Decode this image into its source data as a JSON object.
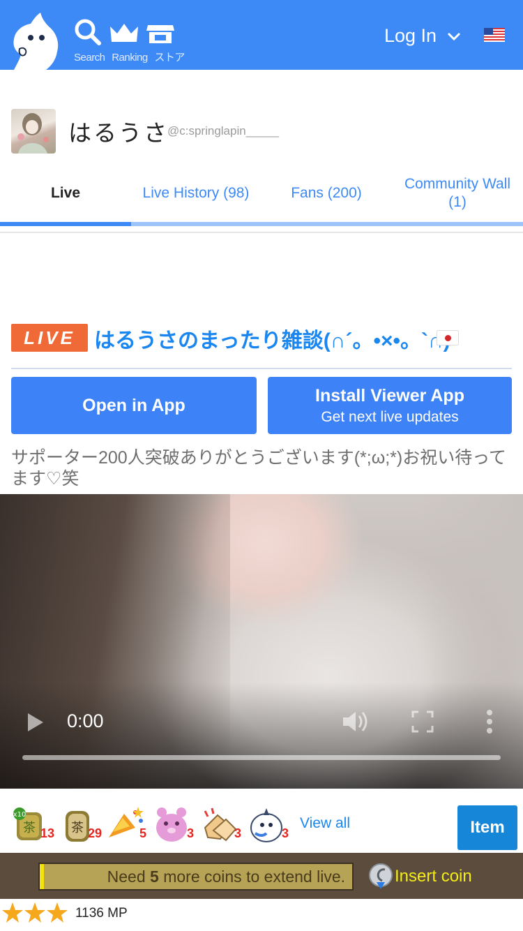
{
  "header": {
    "nav": [
      {
        "icon": "search-icon",
        "label": "Search"
      },
      {
        "icon": "crown-icon",
        "label": "Ranking"
      },
      {
        "icon": "store-icon",
        "label": "ストア"
      }
    ],
    "login_label": "Log In",
    "brand_color": "#3d8af7"
  },
  "profile": {
    "name": "はるうさ",
    "handle": "@c:springlapin_____"
  },
  "tabs": [
    {
      "label": "Live",
      "active": true
    },
    {
      "label": "Live History (98)",
      "active": false
    },
    {
      "label": "Fans (200)",
      "active": false
    },
    {
      "label": "Community Wall (1)",
      "active": false
    }
  ],
  "live": {
    "badge": "LIVE",
    "title": "はるうさのまったり雑談(∩´。•×•。`∩)",
    "badge_color": "#ef6a37"
  },
  "actions": {
    "open_in_app": "Open in App",
    "install_main": "Install Viewer App",
    "install_sub": "Get next live updates"
  },
  "description": "サポーター200人突破ありがとうございます(*;ω;*)お祝い待ってます♡笑",
  "player": {
    "time": "0:00",
    "progress": 0
  },
  "gifts": {
    "items": [
      {
        "icon": "tea-10-icon",
        "count": "13"
      },
      {
        "icon": "tea-icon",
        "count": "29"
      },
      {
        "icon": "party-popper-icon",
        "count": "5"
      },
      {
        "icon": "bear-icon",
        "count": "3"
      },
      {
        "icon": "clap-icon",
        "count": "3"
      },
      {
        "icon": "bird-icon",
        "count": "3"
      }
    ],
    "view_all": "View all",
    "item_button": "Item"
  },
  "coin_bar": {
    "need_prefix": "Need ",
    "need_count": "5",
    "need_suffix": " more coins to extend live.",
    "insert_coin": "Insert coin"
  },
  "rating": {
    "stars": 3,
    "mp": "1136 MP"
  }
}
